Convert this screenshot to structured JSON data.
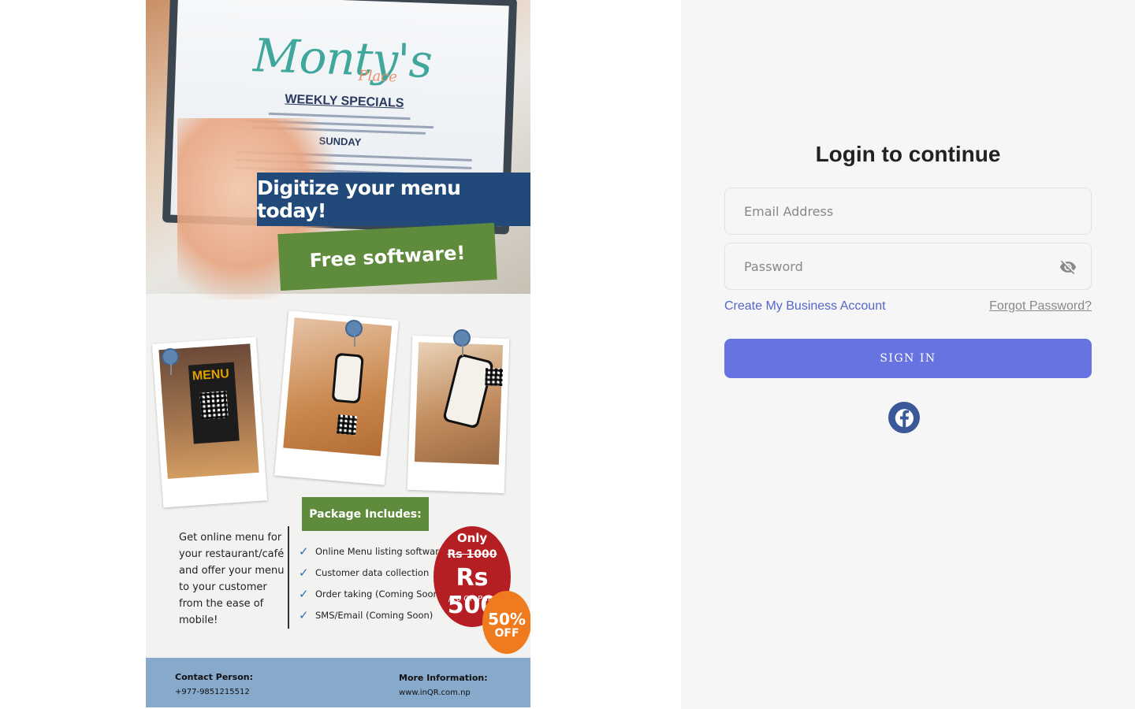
{
  "poster": {
    "menu_logo": "Monty's",
    "menu_logo_sub": "Place",
    "menu_heading": "WEEKLY SPECIALS",
    "menu_day": "SUNDAY",
    "headline": "Digitize your menu today!",
    "subheadline": "Free software!",
    "qr_stand_label": "MENU",
    "package_title": "Package Includes:",
    "description": "Get online menu for your restaurant/café and offer your menu to your customer from the ease of mobile!",
    "features": [
      "Online Menu listing software",
      "Customer data collection",
      "Order taking (Coming Soon)",
      "SMS/Email (Coming Soon)"
    ],
    "price": {
      "only": "Only",
      "old": "Rs 1000",
      "new": "Rs 500",
      "unit": "/10 QR Print"
    },
    "discount": {
      "percent": "50%",
      "label": "OFF"
    },
    "contact_label": "Contact Person:",
    "contact_value": "+977-9851215512",
    "more_info_label": "More Information:",
    "more_info_value": "www.inQR.com.np"
  },
  "login": {
    "title": "Login to continue",
    "email_placeholder": "Email Address",
    "password_placeholder": "Password",
    "create_account": "Create My Business Account",
    "forgot_password": "Forgot Password?",
    "sign_in": "SIGN IN",
    "social": [
      "facebook-icon"
    ]
  },
  "colors": {
    "accent": "#6673e0",
    "link": "#5466cc",
    "facebook": "#3b5998",
    "panel_bg": "#f6f6f6",
    "poster_blue": "#214a7a",
    "poster_green": "#5f8b3c",
    "price_red": "#b51f23",
    "off_orange": "#f07b1f"
  }
}
